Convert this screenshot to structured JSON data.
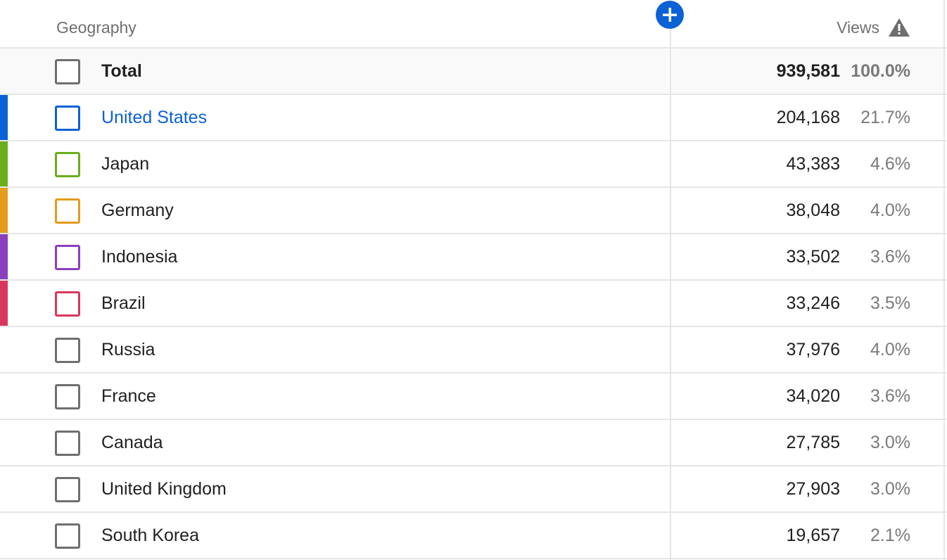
{
  "header": {
    "geography_label": "Geography",
    "views_label": "Views"
  },
  "total": {
    "name": "Total",
    "views": "939,581",
    "percent": "100.0%"
  },
  "rows": [
    {
      "name": "United States",
      "views": "204,168",
      "percent": "21.7%",
      "color": "#0b61d6",
      "highlighted": true
    },
    {
      "name": "Japan",
      "views": "43,383",
      "percent": "4.6%",
      "color": "#6aae1c",
      "highlighted": false
    },
    {
      "name": "Germany",
      "views": "38,048",
      "percent": "4.0%",
      "color": "#e59b1c",
      "highlighted": false
    },
    {
      "name": "Indonesia",
      "views": "33,502",
      "percent": "3.6%",
      "color": "#8a3fbf",
      "highlighted": false
    },
    {
      "name": "Brazil",
      "views": "33,246",
      "percent": "3.5%",
      "color": "#d9365d",
      "highlighted": false
    },
    {
      "name": "Russia",
      "views": "37,976",
      "percent": "4.0%",
      "color": "",
      "highlighted": false
    },
    {
      "name": "France",
      "views": "34,020",
      "percent": "3.6%",
      "color": "",
      "highlighted": false
    },
    {
      "name": "Canada",
      "views": "27,785",
      "percent": "3.0%",
      "color": "",
      "highlighted": false
    },
    {
      "name": "United Kingdom",
      "views": "27,903",
      "percent": "3.0%",
      "color": "",
      "highlighted": false
    },
    {
      "name": "South Korea",
      "views": "19,657",
      "percent": "2.1%",
      "color": "",
      "highlighted": false
    }
  ],
  "icons": {
    "add": "plus-circle-icon",
    "warning": "warning-triangle-icon"
  }
}
